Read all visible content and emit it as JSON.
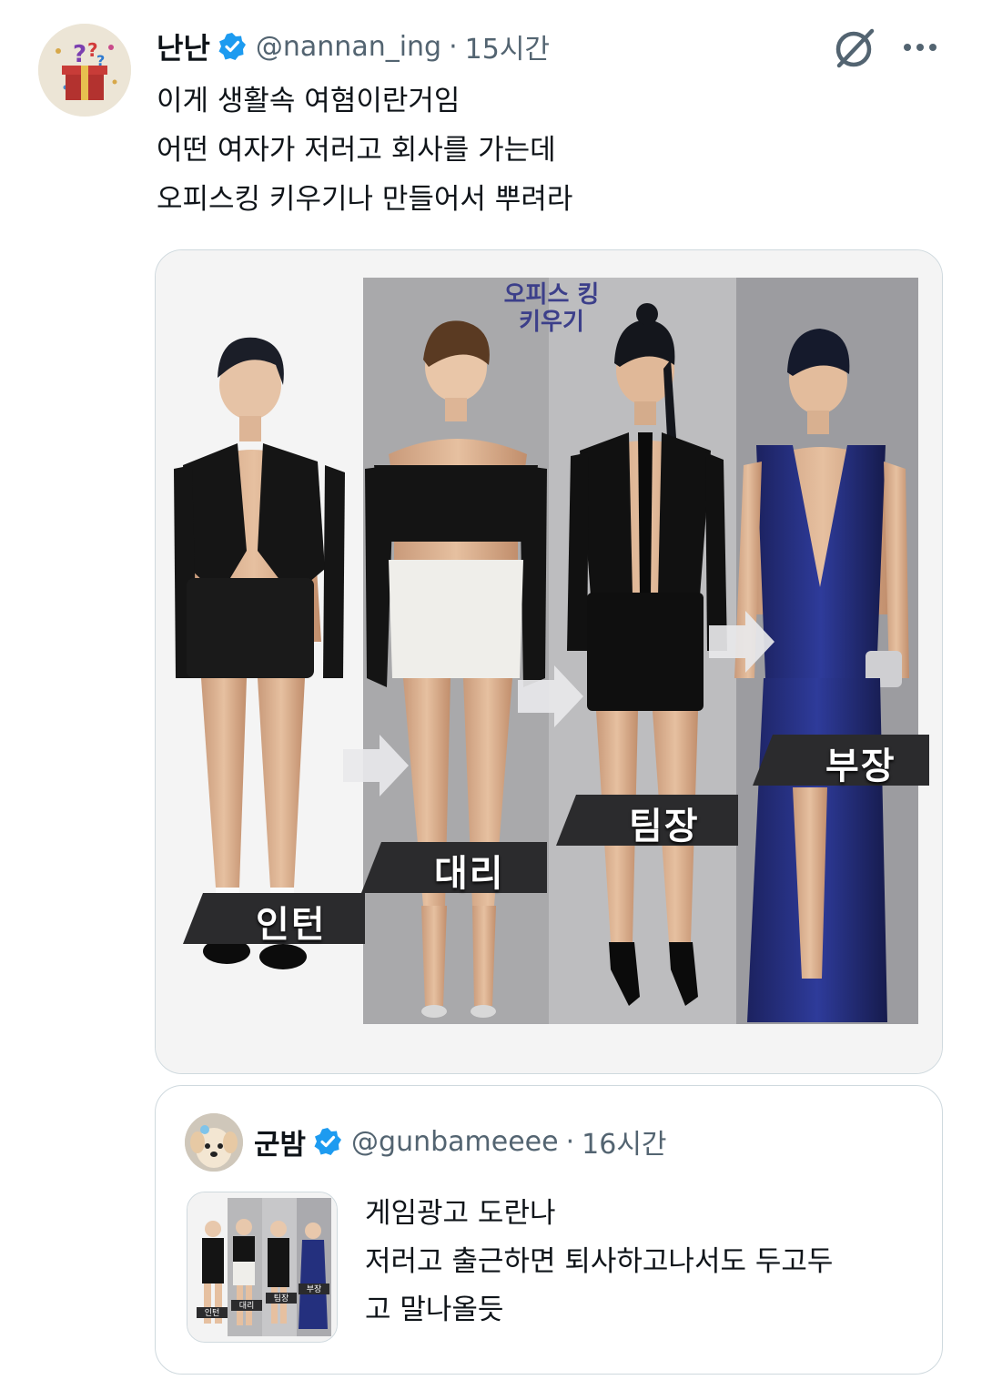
{
  "post": {
    "author_name": "난난",
    "handle": "@nannan_ing",
    "separator": "·",
    "time": "15시간",
    "text_lines": [
      "이게 생활속 여혐이란거임",
      "어떤 여자가 저러고 회사를 가는데",
      "오피스킹 키우기나 만들어서 뿌려라"
    ],
    "verified_icon": "verified-badge-icon",
    "avatar_icon": "gift-box-avatar",
    "grok_icon": "grok-icon",
    "more_icon": "more-dots-icon"
  },
  "media": {
    "game_title_line1": "오피스 킹",
    "game_title_line2": "키우기",
    "ranks": [
      "인턴",
      "대리",
      "팀장",
      "부장"
    ]
  },
  "quote": {
    "author_name": "군밤",
    "handle": "@gunbameeee",
    "separator": "·",
    "time": "16시간",
    "text_lines": [
      "게임광고 도란나",
      "저러고 출근하면 퇴사하고나서도 두고두",
      "고 말나올듯"
    ],
    "thumb_labels": [
      "인턴",
      "대리",
      "팀장",
      "부장"
    ]
  },
  "colors": {
    "accent": "#1d9bf0",
    "text": "#0f1419",
    "secondary": "#536471",
    "border": "#cfd9de"
  }
}
